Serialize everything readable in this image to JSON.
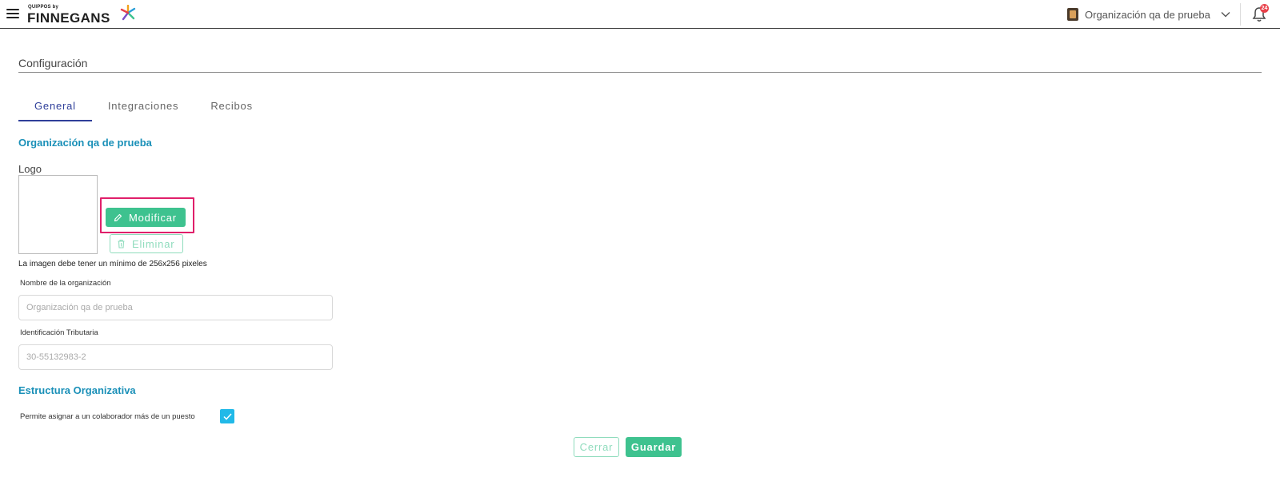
{
  "header": {
    "brand_small": "QUIPPOS by",
    "brand_name": "FINNEGANS",
    "organization": "Organización qa de prueba",
    "notification_count": "24",
    "menu_icon": "hamburger-menu-icon",
    "chevron_icon": "chevron-down-icon",
    "bell_icon": "bell-icon"
  },
  "page": {
    "title": "Configuración"
  },
  "tabs": [
    {
      "label": "General",
      "active": true
    },
    {
      "label": "Integraciones",
      "active": false
    },
    {
      "label": "Recibos",
      "active": false
    }
  ],
  "general": {
    "org_heading": "Organización qa de prueba",
    "logo_label": "Logo",
    "modify_label": "Modificar",
    "delete_label": "Eliminar",
    "image_hint": "La imagen debe tener un mínimo de 256x256 pixeles",
    "org_name_label": "Nombre de la organización",
    "org_name_placeholder": "Organización qa de prueba",
    "tax_id_label": "Identificación Tributaria",
    "tax_id_placeholder": "30-55132983-2"
  },
  "structure": {
    "heading": "Estructura Organizativa",
    "multi_position_label": "Permite asignar a un colaborador más de un puesto",
    "multi_position_checked": true
  },
  "actions": {
    "close_label": "Cerrar",
    "save_label": "Guardar"
  },
  "colors": {
    "primary_green": "#3ec28f",
    "heading_blue": "#1a90b8",
    "tab_active": "#2f3f9a",
    "checkbox_blue": "#21b9e8",
    "highlight_pink": "#e01f6a",
    "badge_red": "#e8414a"
  }
}
